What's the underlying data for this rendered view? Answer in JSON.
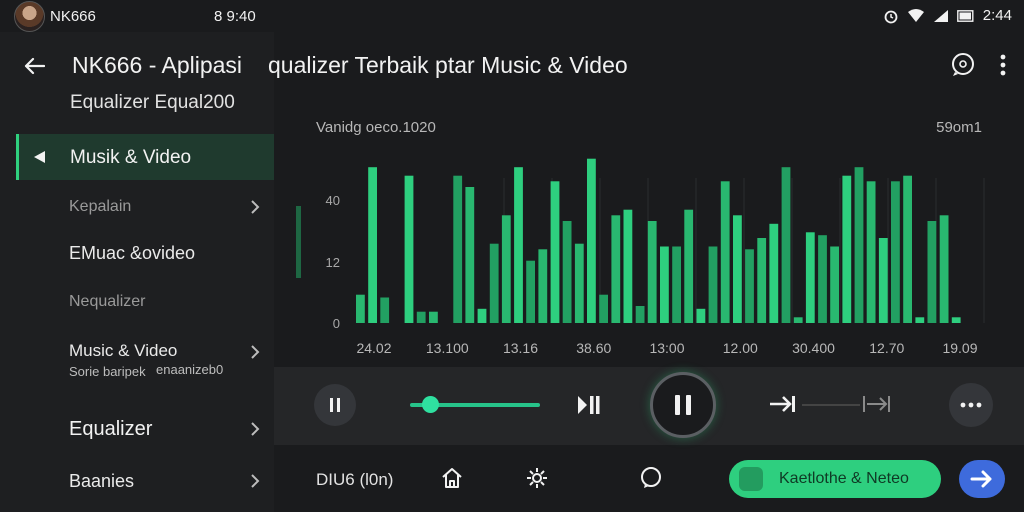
{
  "status_bar": {
    "title": "NK666",
    "time_left": "8 9:40",
    "time_right": "2:44"
  },
  "sidebar": {
    "app_title": "NK666 - Aplipasi",
    "app_subtitle": "Equalizer  Equal200",
    "items": [
      {
        "label": "Musik & Video",
        "active": true,
        "chevron": false
      },
      {
        "label": "Kepalain",
        "chevron": true,
        "muted": true
      },
      {
        "label": "EMuac &ovideo",
        "chevron": false
      },
      {
        "label": "Nequalizer",
        "chevron": false,
        "muted": true
      },
      {
        "label": "Music & Video",
        "sublabel": "Sorie baripek",
        "sublabel2": "enaanizeb0",
        "chevron": true
      },
      {
        "label": "Equalizer",
        "chevron": true
      },
      {
        "label": "Baanies",
        "chevron": true
      }
    ]
  },
  "header": {
    "title": "qualizer Terbaik ptar Music & Video"
  },
  "chart_data": {
    "type": "bar",
    "title": "Vanidg oeco.1020",
    "right_label": "59om1",
    "y_ticks": [
      "40",
      "12",
      "0"
    ],
    "ylim": [
      0,
      60
    ],
    "x_ticks": [
      "24.02",
      "13.100",
      "13.16",
      "38.60",
      "13:00",
      "12.00",
      "30.400",
      "12.70",
      "19.09"
    ],
    "values": [
      10,
      55,
      9,
      0,
      52,
      4,
      4,
      0,
      52,
      48,
      5,
      28,
      38,
      55,
      22,
      26,
      50,
      36,
      28,
      58,
      10,
      38,
      40,
      6,
      36,
      27,
      27,
      40,
      5,
      27,
      50,
      38,
      26,
      30,
      35,
      55,
      2,
      32,
      31,
      27,
      52,
      55,
      50,
      30,
      50,
      52,
      2,
      36,
      38,
      2
    ],
    "color": "#2ecf7f"
  },
  "player": {
    "slider_value": 0.15
  },
  "bottom": {
    "label": "DIU6 (l0n)",
    "pill_label": "Kaetlothe & Neteo"
  }
}
